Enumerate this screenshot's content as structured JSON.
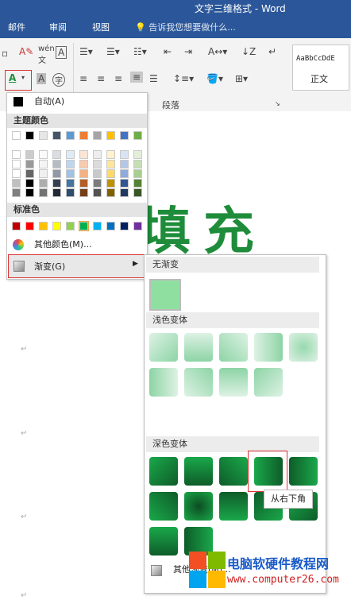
{
  "window": {
    "title": "文字三维格式 - Word"
  },
  "tabs": [
    "邮件",
    "审阅",
    "视图"
  ],
  "tell_me": "告诉我您想要做什么...",
  "ribbon": {
    "paragraph_group": "段落",
    "style_preview": "AaBbCcDdE",
    "style_name": "正文"
  },
  "document": {
    "large_text": "填充"
  },
  "color_menu": {
    "auto": "自动(A)",
    "theme_header": "主题颜色",
    "theme_top": [
      "#ffffff",
      "#000000",
      "#e7e6e6",
      "#44546a",
      "#5b9bd5",
      "#ed7d31",
      "#a5a5a5",
      "#ffc000",
      "#4472c4",
      "#70ad47"
    ],
    "standard_header": "标准色",
    "standard": [
      "#c00000",
      "#ff0000",
      "#ffc000",
      "#ffff00",
      "#92d050",
      "#00b050",
      "#00b0f0",
      "#0070c0",
      "#002060",
      "#7030a0"
    ],
    "more_colors": "其他颜色(M)...",
    "gradient": "渐变(G)"
  },
  "gradient_panel": {
    "no_gradient": "无渐变",
    "light_header": "浅色变体",
    "dark_header": "深色变体",
    "more": "其他渐变(M)...",
    "tooltip": "从右下角",
    "accent": "#1aa84a"
  },
  "watermark": {
    "title": "电脑软硬件教程网",
    "url": "www.computer26.com"
  }
}
